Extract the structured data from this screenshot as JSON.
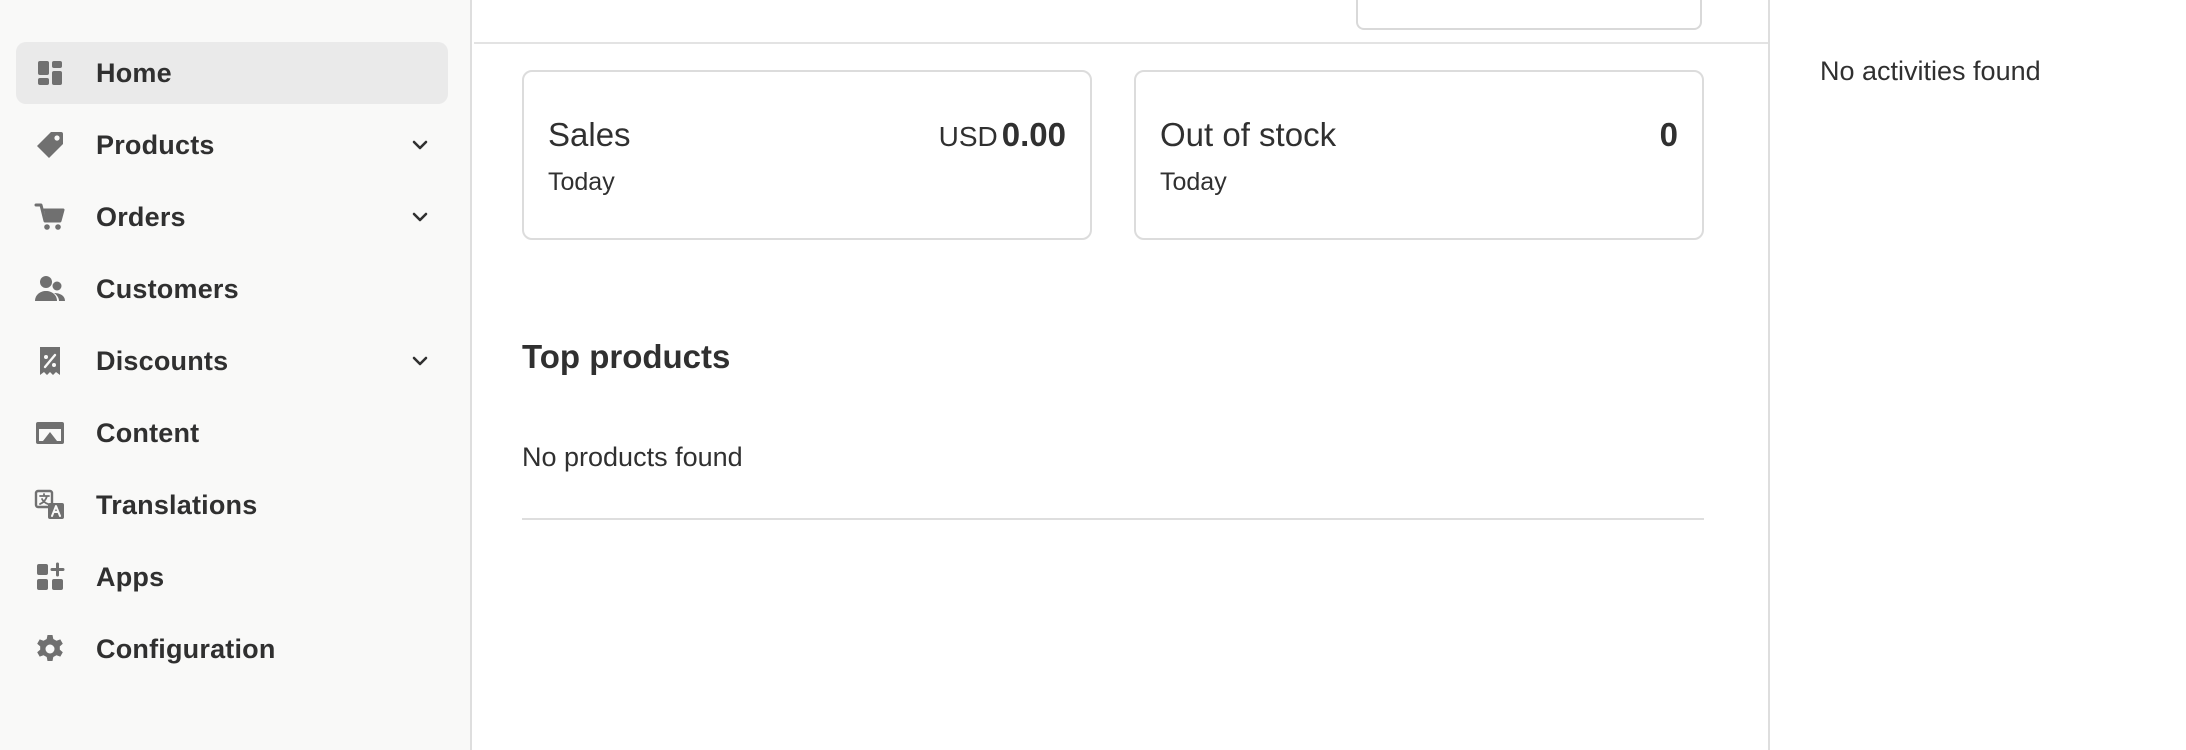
{
  "sidebar": {
    "items": [
      {
        "label": "Home",
        "icon": "home-icon",
        "active": true,
        "expandable": false
      },
      {
        "label": "Products",
        "icon": "tag-icon",
        "active": false,
        "expandable": true
      },
      {
        "label": "Orders",
        "icon": "cart-icon",
        "active": false,
        "expandable": true
      },
      {
        "label": "Customers",
        "icon": "person-icon",
        "active": false,
        "expandable": false
      },
      {
        "label": "Discounts",
        "icon": "discount-icon",
        "active": false,
        "expandable": true
      },
      {
        "label": "Content",
        "icon": "image-icon",
        "active": false,
        "expandable": false
      },
      {
        "label": "Translations",
        "icon": "language-icon",
        "active": false,
        "expandable": false
      },
      {
        "label": "Apps",
        "icon": "apps-icon",
        "active": false,
        "expandable": false
      },
      {
        "label": "Configuration",
        "icon": "gear-icon",
        "active": false,
        "expandable": false
      }
    ]
  },
  "main": {
    "cards": {
      "sales": {
        "title": "Sales",
        "subtitle": "Today",
        "currency": "USD",
        "value": "0.00"
      },
      "out_of_stock": {
        "title": "Out of stock",
        "subtitle": "Today",
        "value": "0"
      }
    },
    "top_products": {
      "title": "Top products",
      "empty": "No products found"
    }
  },
  "activity_panel": {
    "empty": "No activities found"
  },
  "colors": {
    "sidebar_bg": "#f9f9f8",
    "active_item_bg": "#eaeaea",
    "icon": "#707070",
    "text": "#303030",
    "border": "#dedede"
  }
}
